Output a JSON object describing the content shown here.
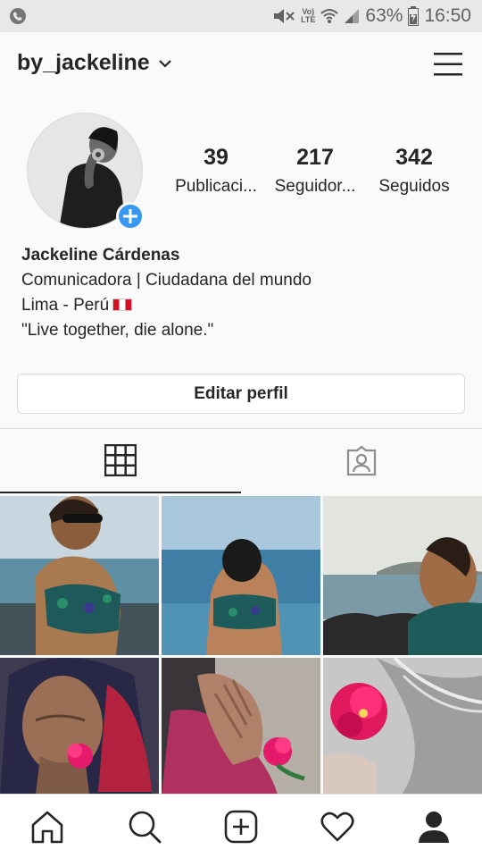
{
  "status_bar": {
    "battery_text": "63%",
    "time": "16:50",
    "network_label_top": "Vo)",
    "network_label_bottom": "LTE"
  },
  "header": {
    "username": "by_jackeline"
  },
  "profile": {
    "stats": [
      {
        "value": "39",
        "label": "Publicaci..."
      },
      {
        "value": "217",
        "label": "Seguidor..."
      },
      {
        "value": "342",
        "label": "Seguidos"
      }
    ],
    "name": "Jackeline Cárdenas",
    "bio_line1": "Comunicadora | Ciudadana del mundo",
    "bio_line2": "Lima - Perú",
    "bio_line3": "\"Live together, die alone.\""
  },
  "actions": {
    "edit_profile": "Editar perfil"
  },
  "tabs": [
    {
      "icon": "grid-icon",
      "active": true
    },
    {
      "icon": "tagged-portrait-icon",
      "active": false
    }
  ],
  "grid_posts": [
    {
      "subject": "woman-sunglasses-beach"
    },
    {
      "subject": "woman-back-ocean"
    },
    {
      "subject": "woman-profile-rocks"
    },
    {
      "subject": "elderly-woman-headscarf-flower"
    },
    {
      "subject": "elderly-hand-flower"
    },
    {
      "subject": "pink-flower-gray-hair"
    }
  ],
  "bottom_nav": [
    {
      "icon": "home-icon"
    },
    {
      "icon": "search-icon"
    },
    {
      "icon": "new-post-icon"
    },
    {
      "icon": "heart-icon"
    },
    {
      "icon": "profile-icon"
    }
  ],
  "colors": {
    "accent_blue": "#3897f0",
    "text": "#262626",
    "divider": "#dbdbdb",
    "background": "#fafafa"
  }
}
